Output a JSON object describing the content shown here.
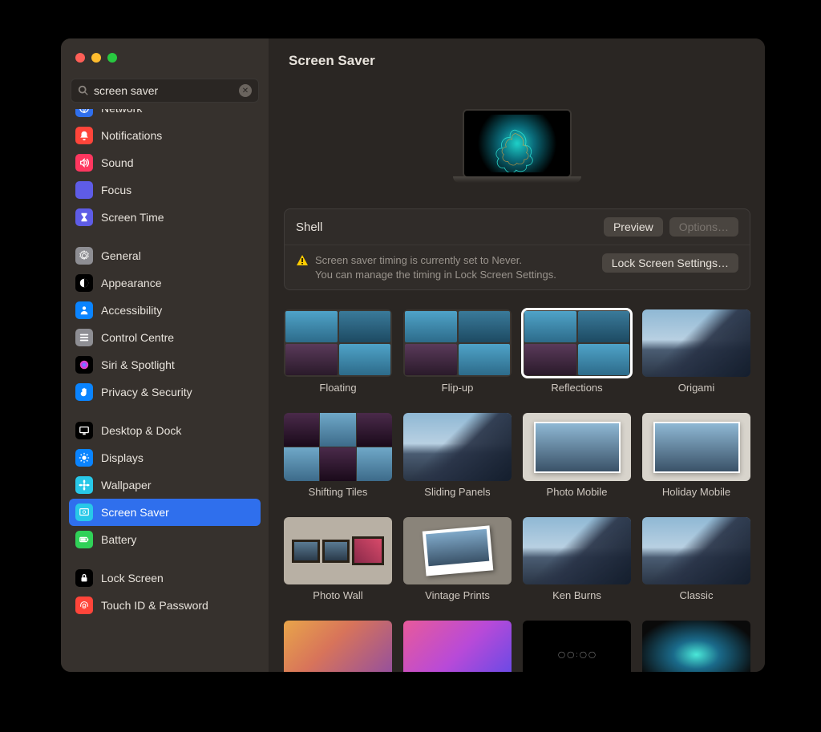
{
  "search": {
    "value": "screen saver"
  },
  "sidebar": {
    "groups": [
      {
        "items": [
          {
            "id": "network",
            "label": "Network",
            "color": "#2f6fed",
            "icon": "globe"
          },
          {
            "id": "notifications",
            "label": "Notifications",
            "color": "#ff453a",
            "icon": "bell"
          },
          {
            "id": "sound",
            "label": "Sound",
            "color": "#ff375f",
            "icon": "speaker"
          },
          {
            "id": "focus",
            "label": "Focus",
            "color": "#5e5ce6",
            "icon": "moon"
          },
          {
            "id": "screentime",
            "label": "Screen Time",
            "color": "#5e5ce6",
            "icon": "hourglass"
          }
        ]
      },
      {
        "items": [
          {
            "id": "general",
            "label": "General",
            "color": "#8e8e93",
            "icon": "gear"
          },
          {
            "id": "appearance",
            "label": "Appearance",
            "color": "#000",
            "icon": "circle-half"
          },
          {
            "id": "accessibility",
            "label": "Accessibility",
            "color": "#0a84ff",
            "icon": "person"
          },
          {
            "id": "controlcentre",
            "label": "Control Centre",
            "color": "#8e8e93",
            "icon": "sliders"
          },
          {
            "id": "siri",
            "label": "Siri & Spotlight",
            "color": "#000",
            "icon": "siri"
          },
          {
            "id": "privacy",
            "label": "Privacy & Security",
            "color": "#0a84ff",
            "icon": "hand"
          }
        ]
      },
      {
        "items": [
          {
            "id": "desktop",
            "label": "Desktop & Dock",
            "color": "#000",
            "icon": "desktop"
          },
          {
            "id": "displays",
            "label": "Displays",
            "color": "#0a84ff",
            "icon": "sun"
          },
          {
            "id": "wallpaper",
            "label": "Wallpaper",
            "color": "#28c8e8",
            "icon": "flower"
          },
          {
            "id": "screensaver",
            "label": "Screen Saver",
            "color": "#28c8e8",
            "icon": "saver",
            "active": true
          },
          {
            "id": "battery",
            "label": "Battery",
            "color": "#30d158",
            "icon": "battery"
          }
        ]
      },
      {
        "items": [
          {
            "id": "lockscreen",
            "label": "Lock Screen",
            "color": "#000",
            "icon": "lock"
          },
          {
            "id": "touchid",
            "label": "Touch ID & Password",
            "color": "#ff453a",
            "icon": "finger"
          }
        ]
      }
    ]
  },
  "main": {
    "title": "Screen Saver",
    "current_name": "Shell",
    "preview_btn": "Preview",
    "options_btn": "Options…",
    "warn_line1": "Screen saver timing is currently set to Never.",
    "warn_line2": "You can manage the timing in Lock Screen Settings.",
    "lockscreen_btn": "Lock Screen Settings…",
    "savers": [
      {
        "id": "floating",
        "label": "Floating",
        "variant": "mosaic"
      },
      {
        "id": "flipup",
        "label": "Flip-up",
        "variant": "mosaic"
      },
      {
        "id": "reflections",
        "label": "Reflections",
        "variant": "mosaic",
        "selected": true
      },
      {
        "id": "origami",
        "label": "Origami",
        "variant": "mtn"
      },
      {
        "id": "shifting",
        "label": "Shifting Tiles",
        "variant": "tiles3"
      },
      {
        "id": "sliding",
        "label": "Sliding Panels",
        "variant": "mtn"
      },
      {
        "id": "photomobile",
        "label": "Photo Mobile",
        "variant": "framed"
      },
      {
        "id": "holidaymobile",
        "label": "Holiday Mobile",
        "variant": "framed"
      },
      {
        "id": "photowall",
        "label": "Photo Wall",
        "variant": "wall"
      },
      {
        "id": "vintage",
        "label": "Vintage Prints",
        "variant": "polaroid"
      },
      {
        "id": "kenburns",
        "label": "Ken Burns",
        "variant": "mtn"
      },
      {
        "id": "classic",
        "label": "Classic",
        "variant": "mtn"
      },
      {
        "id": "extra1",
        "label": "",
        "variant": "abstract1"
      },
      {
        "id": "extra2",
        "label": "",
        "variant": "abstract2"
      },
      {
        "id": "extra3",
        "label": "",
        "variant": "clock"
      },
      {
        "id": "extra4",
        "label": "",
        "variant": "fractal"
      }
    ]
  }
}
